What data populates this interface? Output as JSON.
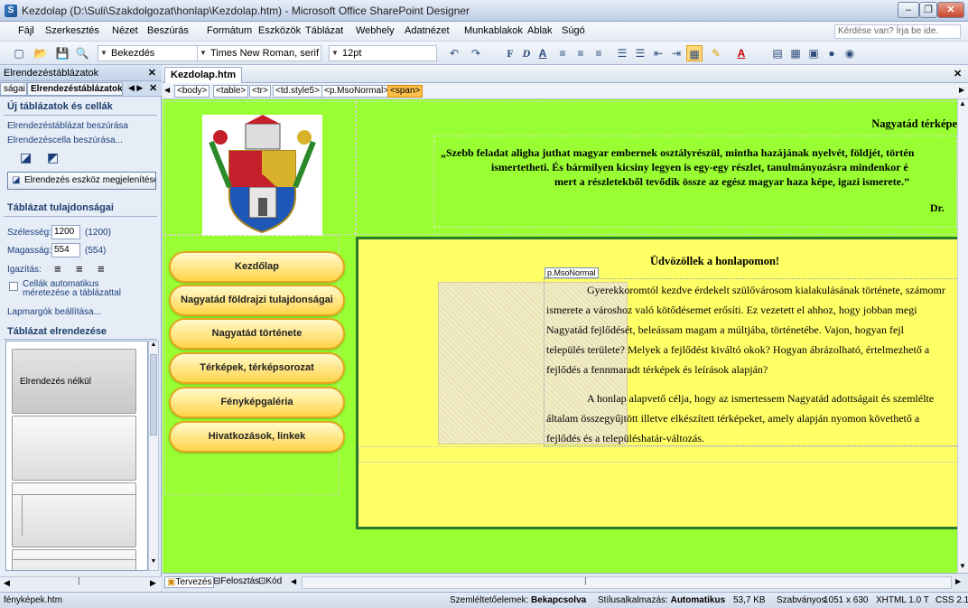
{
  "window": {
    "title": "Kezdolap (D:\\Suli\\Szakdolgozat\\honlap\\Kezdolap.htm) - Microsoft Office SharePoint Designer"
  },
  "menu": {
    "items": [
      "Fájl",
      "Szerkesztés",
      "Nézet",
      "Beszúrás",
      "Formátum",
      "Eszközök",
      "Táblázat",
      "Webhely",
      "Adatnézet",
      "Munkablakok",
      "Ablak",
      "Súgó"
    ],
    "help_placeholder": "Kérdése van? Írja be ide."
  },
  "toolbar": {
    "style": "Bekezdés",
    "font": "Times New Roman, serif",
    "size": "12pt"
  },
  "left_panel": {
    "title": "Elrendezéstáblázatok",
    "tabs": [
      "ságai",
      "Elrendezéstáblázatok"
    ],
    "section1": "Új táblázatok és cellák",
    "link_insert_table": "Elrendezéstáblázat beszúrása",
    "link_insert_cell": "Elrendezéscella beszúrása...",
    "show_tool": "Elrendezés eszköz megjelenítése",
    "section2": "Táblázat tulajdonságai",
    "width_label": "Szélesség:",
    "width_value": "1200",
    "width_hint": "(1200)",
    "height_label": "Magasság:",
    "height_value": "554",
    "height_hint": "(554)",
    "align_label": "Igazítás:",
    "auto_resize": "Cellák automatikus méretezése a táblázattal",
    "margins_link": "Lapmargók beállítása...",
    "section3": "Táblázat elrendezése",
    "layout_none": "Elrendezés nélkül"
  },
  "document": {
    "tab": "Kezdolap.htm",
    "breadcrumbs": [
      "<body>",
      "<table>",
      "<tr>",
      "<td.style5>",
      "<p.MsoNormal>",
      "<span>"
    ],
    "header_title": "Nagyatád térképe",
    "quote_line1": "„Szebb feladat aligha juthat magyar embernek osztályrészül, mintha hazájának  nyelvét, földjét, történ",
    "quote_line2": "ismertetheti.  És bármilyen kicsiny  legyen is egy-egy részlet, tanulmányozásra mindenkor é",
    "quote_line3": "mert a  részletekből tevődik össze az egész magyar haza képe, igazi ismerete.”",
    "quote_author": "Dr. ",
    "nav": [
      "Kezdőlap",
      "Nagyatád földrajzi tulajdonságai",
      "Nagyatád története",
      "Térképek, térképsorozat",
      "Fényképgaléria",
      "Hivatkozások, linkek"
    ],
    "welcome": "Üdvözöllek a honlapomon!",
    "tag_label": "p.MsoNormal",
    "para1": [
      "Gyerekkoromtól kezdve érdekelt szülővárosom kialakulásának története, számomr",
      "ismerete a városhoz való kötődésemet erősíti. Ez vezetett el ahhoz, hogy jobban megi",
      "Nagyatád fejlődését, beleássam magam a múltjába, történetébe. Vajon, hogyan fejl",
      "település területe? Melyek a fejlődést kiváltó okok? Hogyan ábrázolható, értelmezhető a",
      "fejlődés a fennmaradt térképek és leírások alapján?"
    ],
    "para2": [
      "A honlap alapvető célja, hogy az ismertessem Nagyatád adottságait és szemlélte",
      "általam összegyűjtött illetve elkészített térképeket, amely alapján nyomon követhető a",
      "fejlődés és a településhatár-változás."
    ],
    "view_tabs": [
      "Tervezés",
      "Felosztás",
      "Kód"
    ]
  },
  "status": {
    "left": "fényképek.htm",
    "visual_label": "Szemléltetőelemek:",
    "visual_value": "Bekapcsolva",
    "style_label": "Stílusalkalmazás:",
    "style_value": "Automatikus",
    "size": "53,7 KB",
    "mode": "Szabványos",
    "dims": "1051 x 630",
    "doctype": "XHTML 1.0 T",
    "css": "CSS 2.1"
  },
  "colors": {
    "page_bg": "#99ff33",
    "content_bg": "#ffff66",
    "border": "#2a7a2a",
    "button": "#ffd44a"
  }
}
